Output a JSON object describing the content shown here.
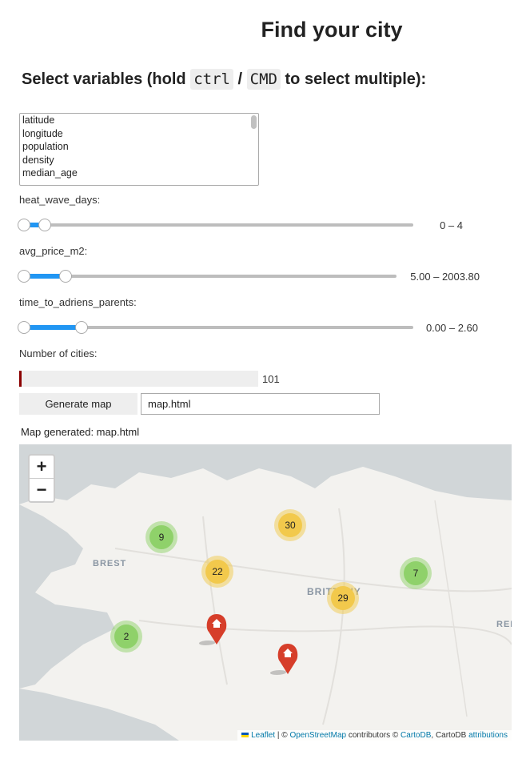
{
  "title": "Find your city",
  "subtitle": {
    "pre": "Select variables (hold ",
    "key1": "ctrl",
    "sep": " / ",
    "key2": "CMD",
    "post": " to select multiple):"
  },
  "variables": [
    "latitude",
    "longitude",
    "population",
    "density",
    "median_age"
  ],
  "sliders": [
    {
      "label": "heat_wave_days:",
      "value_text": "0 – 4",
      "low": 0,
      "high": 4
    },
    {
      "label": "avg_price_m2:",
      "value_text": "5.00 – 2003.80",
      "low": 5.0,
      "high": 2003.8
    },
    {
      "label": "time_to_adriens_parents:",
      "value_text": "0.00 – 2.60",
      "low": 0.0,
      "high": 2.6
    }
  ],
  "cities": {
    "label": "Number of cities:",
    "count": "101"
  },
  "generate_button": "Generate map",
  "filename": "map.html",
  "status": "Map generated: map.html",
  "map": {
    "zoom_in": "+",
    "zoom_out": "−",
    "place_labels": [
      "BREST",
      "BRITTANY",
      "REN"
    ],
    "clusters": [
      {
        "count": "9",
        "color": "green"
      },
      {
        "count": "30",
        "color": "yellow"
      },
      {
        "count": "22",
        "color": "yellow"
      },
      {
        "count": "29",
        "color": "yellow"
      },
      {
        "count": "7",
        "color": "green"
      },
      {
        "count": "2",
        "color": "green"
      }
    ],
    "markers": [
      "home-marker",
      "home-marker"
    ],
    "attribution": {
      "leaflet": "Leaflet",
      "sep1": " | © ",
      "osm": "OpenStreetMap",
      "mid": " contributors © ",
      "carto": "CartoDB",
      "mid2": ", CartoDB ",
      "attributions": "attributions"
    }
  },
  "colors": {
    "accent": "#2196f3",
    "progress": "#8b0000",
    "cluster_green": "#8fd16a",
    "cluster_yellow": "#f2c94c",
    "marker_red": "#d63e2a"
  }
}
